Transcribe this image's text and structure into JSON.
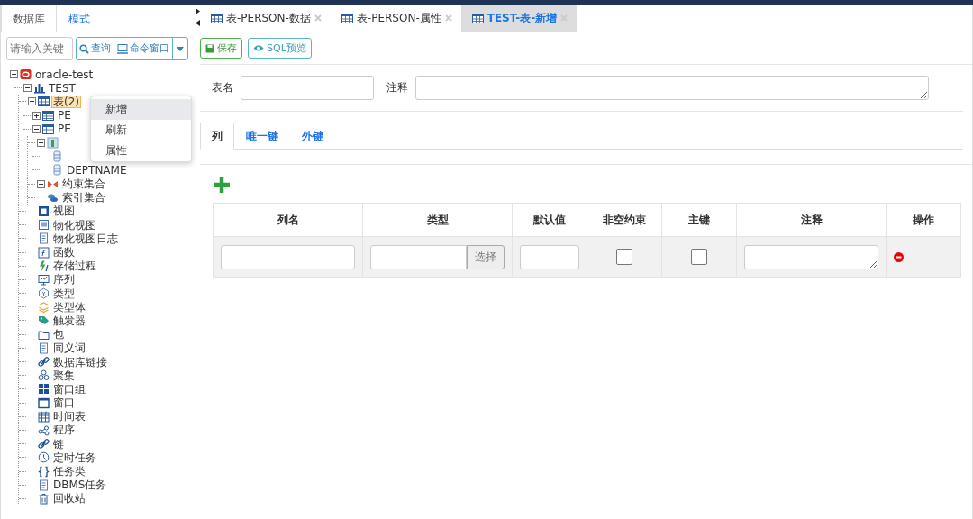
{
  "left_panel": {
    "tabs": [
      {
        "label": "数据库",
        "selected": true
      },
      {
        "label": "模式",
        "selected": false
      }
    ],
    "search": {
      "placeholder": "请输入关键"
    },
    "buttons": [
      {
        "label": "查询",
        "kind": "search"
      },
      {
        "label": "命令窗口",
        "kind": "monitor"
      }
    ],
    "tree": [
      {
        "label": "oracle-test",
        "kind": "database",
        "expanded": true,
        "children": [
          {
            "label": "TEST",
            "kind": "schema",
            "expanded": true,
            "children": [
              {
                "label": "表(2)",
                "kind": "table",
                "expanded": true,
                "selected": true,
                "children": [
                  {
                    "label": "PE",
                    "kind": "table",
                    "expanded": false,
                    "selected": false
                  },
                  {
                    "label": "PE",
                    "kind": "table",
                    "expanded": true,
                    "selected": false,
                    "children": [
                      {
                        "kind": "columns",
                        "expanded": true,
                        "children": [
                          {
                            "kind": "column"
                          },
                          {
                            "label": "DEPTNAME",
                            "kind": "column",
                            "selected": false
                          }
                        ]
                      },
                      {
                        "label": "约束集合",
                        "kind": "constraint",
                        "expanded": false,
                        "selected": false
                      },
                      {
                        "label": "索引集合",
                        "kind": "index",
                        "selected": false
                      }
                    ]
                  }
                ]
              },
              {
                "label": "视图",
                "kind": "view",
                "selected": false
              },
              {
                "label": "物化视图",
                "kind": "panel",
                "selected": false
              },
              {
                "label": "物化视图日志",
                "kind": "doc",
                "selected": false
              },
              {
                "label": "函数",
                "kind": "function",
                "selected": false
              },
              {
                "label": "存储过程",
                "kind": "bolt",
                "selected": false
              },
              {
                "label": "序列",
                "kind": "monitor",
                "selected": false
              },
              {
                "label": "类型",
                "kind": "circle",
                "selected": false
              },
              {
                "label": "类型体",
                "kind": "layers",
                "selected": false
              },
              {
                "label": "触发器",
                "kind": "tag",
                "selected": false
              },
              {
                "label": "包",
                "kind": "folder",
                "selected": false
              },
              {
                "label": "同义词",
                "kind": "doc",
                "selected": false
              },
              {
                "label": "数据库链接",
                "kind": "link",
                "selected": false
              },
              {
                "label": "聚集",
                "kind": "circles",
                "selected": false
              },
              {
                "label": "窗口组",
                "kind": "windows",
                "selected": false
              },
              {
                "label": "窗口",
                "kind": "window",
                "selected": false
              },
              {
                "label": "时间表",
                "kind": "calendar",
                "selected": false
              },
              {
                "label": "程序",
                "kind": "nodes",
                "selected": false
              },
              {
                "label": "链",
                "kind": "link",
                "selected": false
              },
              {
                "label": "定时任务",
                "kind": "clock",
                "selected": false
              },
              {
                "label": "任务类",
                "kind": "braces",
                "selected": false
              },
              {
                "label": "DBMS任务",
                "kind": "doc",
                "selected": false
              },
              {
                "label": "回收站",
                "kind": "trash",
                "selected": false
              }
            ]
          }
        ]
      }
    ]
  },
  "context_menu": {
    "items": [
      {
        "label": "新增",
        "selected": true
      },
      {
        "label": "刷新",
        "selected": false
      },
      {
        "label": "属性",
        "selected": false
      }
    ]
  },
  "editor_tabs": [
    {
      "label": "表-PERSON-数据",
      "selected": false
    },
    {
      "label": "表-PERSON-属性",
      "selected": false
    },
    {
      "label": "TEST-表-新增",
      "selected": true
    }
  ],
  "toolbar": [
    {
      "label": "保存",
      "kind": "save"
    },
    {
      "label": "SQL预览",
      "kind": "eye"
    }
  ],
  "form": {
    "fields": [
      {
        "label": "表名",
        "kind": "input"
      },
      {
        "label": "注释",
        "kind": "textarea"
      }
    ]
  },
  "sub_tabs": [
    {
      "label": "列",
      "selected": true
    },
    {
      "label": "唯一键",
      "selected": false
    },
    {
      "label": "外键",
      "selected": false
    }
  ],
  "table": {
    "columns": [
      "列名",
      "类型",
      "默认值",
      "非空约束",
      "主键",
      "注释",
      "操作"
    ],
    "rows": [
      {
        "cells": [
          {
            "kind": "input"
          },
          {
            "kind": "select",
            "button": "选择"
          },
          {
            "kind": "input"
          },
          {
            "kind": "checkbox",
            "checked": false
          },
          {
            "kind": "checkbox",
            "checked": false
          },
          {
            "kind": "textarea"
          },
          {
            "kind": "delete"
          }
        ]
      }
    ]
  }
}
